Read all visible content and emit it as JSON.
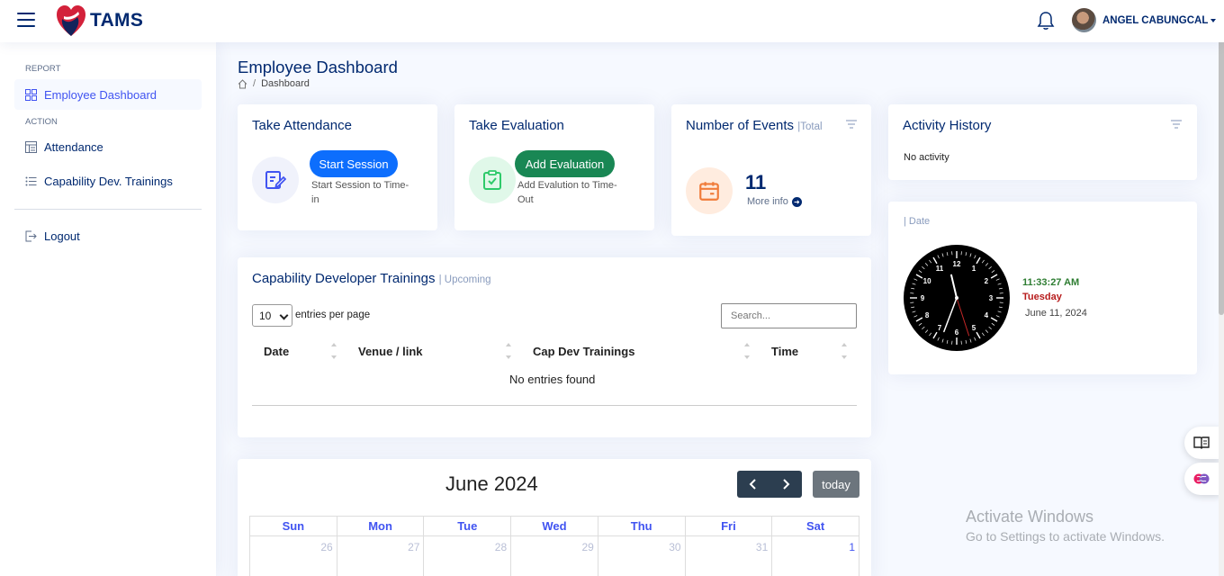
{
  "header": {
    "app_name": "TAMS",
    "user_name": "ANGEL CABUNGCAL"
  },
  "sidebar": {
    "heading_report": "REPORT",
    "heading_action": "ACTION",
    "items": [
      {
        "label": "Employee Dashboard",
        "icon": "grid-icon",
        "active": true
      },
      {
        "label": "Attendance",
        "icon": "layout-icon"
      },
      {
        "label": "Capability Dev. Trainings",
        "icon": "list-icon"
      },
      {
        "label": "Logout",
        "icon": "logout-icon"
      }
    ]
  },
  "page": {
    "title": "Employee Dashboard",
    "breadcrumb": "Dashboard"
  },
  "cards": {
    "attendance": {
      "title": "Take Attendance",
      "button": "Start Session",
      "desc_line1": "Start Session to Time-",
      "desc_line2": "in"
    },
    "evaluation": {
      "title": "Take Evaluation",
      "button": "Add Evaluation",
      "desc_line1": "Add Evalution to Time-",
      "desc_line2": "Out"
    },
    "events": {
      "title": "Number of Events",
      "subtitle": "|Total",
      "count": "11",
      "more_info": "More info"
    },
    "activity": {
      "title": "Activity History",
      "empty": "No activity"
    },
    "date": {
      "subtitle": "| Date",
      "time": "11:33:27 AM",
      "day": "Tuesday",
      "date": "June 11, 2024",
      "clock": {
        "hour": 11,
        "minute": 33,
        "second": 27
      }
    }
  },
  "trainings": {
    "title": "Capability Developer Trainings",
    "subtitle": "| Upcoming",
    "page_size": "10",
    "entries_label": "entries per page",
    "search_placeholder": "Search...",
    "columns": [
      "Date",
      "Venue / link",
      "Cap Dev Trainings",
      "Time"
    ],
    "empty": "No entries found"
  },
  "calendar": {
    "title": "June 2024",
    "today_label": "today",
    "weekdays": [
      "Sun",
      "Mon",
      "Tue",
      "Wed",
      "Thu",
      "Fri",
      "Sat"
    ],
    "first_row": [
      "26",
      "27",
      "28",
      "29",
      "30",
      "31",
      "1"
    ]
  },
  "watermark": {
    "line1": "Activate Windows",
    "line2": "Go to Settings to activate Windows."
  },
  "colors": {
    "primary": "#4154f1",
    "navy": "#012970",
    "start_btn": "#0d6efd",
    "eval_btn": "#198754",
    "events_icon": "#f07c3a"
  }
}
